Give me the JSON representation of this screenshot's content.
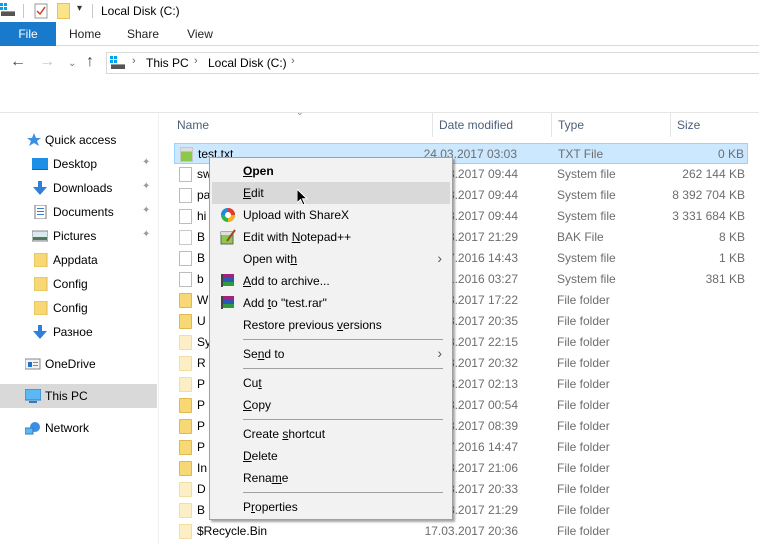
{
  "window": {
    "title": "Local Disk (C:)"
  },
  "ribbon": {
    "tabs": [
      {
        "label": "File",
        "active": true
      },
      {
        "label": "Home"
      },
      {
        "label": "Share"
      },
      {
        "label": "View"
      }
    ],
    "accent_color": "#1979ca"
  },
  "nav": {
    "back": "←",
    "forward": "→",
    "recent": "⌄",
    "up": "↑",
    "breadcrumb": [
      "This PC",
      "Local Disk (C:)"
    ],
    "separator": "›"
  },
  "sidebar": {
    "items": [
      {
        "label": "Quick access",
        "icon": "star-icon",
        "pinned": false
      },
      {
        "label": "Desktop",
        "icon": "desktop-icon",
        "pinned": true
      },
      {
        "label": "Downloads",
        "icon": "download-icon",
        "pinned": true
      },
      {
        "label": "Documents",
        "icon": "documents-icon",
        "pinned": true
      },
      {
        "label": "Pictures",
        "icon": "pictures-icon",
        "pinned": true
      },
      {
        "label": "Appdata",
        "icon": "folder-icon",
        "pinned": false
      },
      {
        "label": "Config",
        "icon": "folder-icon",
        "pinned": false
      },
      {
        "label": "Config",
        "icon": "folder-icon",
        "pinned": false
      },
      {
        "label": "Разное",
        "icon": "download-icon",
        "pinned": false
      },
      {
        "label": "OneDrive",
        "icon": "onedrive-icon",
        "pinned": false
      },
      {
        "label": "This PC",
        "icon": "computer-icon",
        "pinned": false,
        "selected": true
      },
      {
        "label": "Network",
        "icon": "network-icon",
        "pinned": false
      }
    ],
    "pin_glyph": "📌"
  },
  "filelist": {
    "columns": [
      "Name",
      "Date modified",
      "Type",
      "Size"
    ],
    "rows": [
      {
        "name": "test.txt",
        "date": "24.03.2017 03:03",
        "type": "TXT File",
        "size": "0 KB",
        "icon": "text-file-icon",
        "selected": true
      },
      {
        "name": "sw",
        "date": "03.2017 09:44",
        "type": "System file",
        "size": "262 144 KB",
        "icon": "system-file-icon"
      },
      {
        "name": "pa",
        "date": "03.2017 09:44",
        "type": "System file",
        "size": "8 392 704 KB",
        "icon": "system-file-icon"
      },
      {
        "name": "hi",
        "date": "03.2017 09:44",
        "type": "System file",
        "size": "3 331 684 KB",
        "icon": "system-file-icon"
      },
      {
        "name": "B",
        "date": "03.2017 21:29",
        "type": "BAK File",
        "size": "8 KB",
        "icon": "file-icon"
      },
      {
        "name": "B",
        "date": "07.2016 14:43",
        "type": "System file",
        "size": "1 KB",
        "icon": "system-file-icon"
      },
      {
        "name": "b",
        "date": "11.2016 03:27",
        "type": "System file",
        "size": "381 KB",
        "icon": "system-file-icon"
      },
      {
        "name": "W",
        "date": "03.2017 17:22",
        "type": "File folder",
        "size": "",
        "icon": "folder-icon"
      },
      {
        "name": "U",
        "date": "03.2017 20:35",
        "type": "File folder",
        "size": "",
        "icon": "folder-icon"
      },
      {
        "name": "Sy",
        "date": "03.2017 22:15",
        "type": "File folder",
        "size": "",
        "icon": "hidden-folder-icon"
      },
      {
        "name": "R",
        "date": "03.2017 20:32",
        "type": "File folder",
        "size": "",
        "icon": "hidden-folder-icon"
      },
      {
        "name": "P",
        "date": "03.2017 02:13",
        "type": "File folder",
        "size": "",
        "icon": "hidden-folder-icon"
      },
      {
        "name": "P",
        "date": "03.2017 00:54",
        "type": "File folder",
        "size": "",
        "icon": "folder-icon"
      },
      {
        "name": "P",
        "date": "03.2017 08:39",
        "type": "File folder",
        "size": "",
        "icon": "folder-icon"
      },
      {
        "name": "P",
        "date": "07.2016 14:47",
        "type": "File folder",
        "size": "",
        "icon": "folder-icon"
      },
      {
        "name": "In",
        "date": "03.2017 21:06",
        "type": "File folder",
        "size": "",
        "icon": "folder-icon"
      },
      {
        "name": "D",
        "date": "03.2017 20:33",
        "type": "File folder",
        "size": "",
        "icon": "shortcut-folder-icon"
      },
      {
        "name": "B",
        "date": "03.2017 21:29",
        "type": "File folder",
        "size": "",
        "icon": "hidden-folder-icon"
      },
      {
        "name": "$Recycle.Bin",
        "date": "17.03.2017 20:36",
        "type": "File folder",
        "size": "",
        "icon": "hidden-folder-icon"
      }
    ]
  },
  "context_menu": {
    "items": [
      {
        "label": "Open",
        "accel": "O",
        "bold": true
      },
      {
        "label": "Edit",
        "accel": "E",
        "hover": true
      },
      {
        "label": "Upload with ShareX",
        "icon": "sharex-icon"
      },
      {
        "label": "Edit with Notepad++",
        "accel": "N",
        "icon": "notepadpp-icon"
      },
      {
        "label": "Open with",
        "accel": "h",
        "submenu": true
      },
      {
        "label": "Add to archive...",
        "accel": "A",
        "icon": "winrar-icon"
      },
      {
        "label": "Add to \"test.rar\"",
        "accel": "t",
        "icon": "winrar-icon"
      },
      {
        "label": "Restore previous versions",
        "accel": "v"
      },
      {
        "separator": true
      },
      {
        "label": "Send to",
        "accel": "n",
        "submenu": true
      },
      {
        "separator": true
      },
      {
        "label": "Cut",
        "accel": "t"
      },
      {
        "label": "Copy",
        "accel": "C"
      },
      {
        "separator": true
      },
      {
        "label": "Create shortcut",
        "accel": "s"
      },
      {
        "label": "Delete",
        "accel": "D"
      },
      {
        "label": "Rename",
        "accel": "m"
      },
      {
        "separator": true
      },
      {
        "label": "Properties",
        "accel": "r"
      }
    ],
    "submenu_arrow": "›"
  }
}
